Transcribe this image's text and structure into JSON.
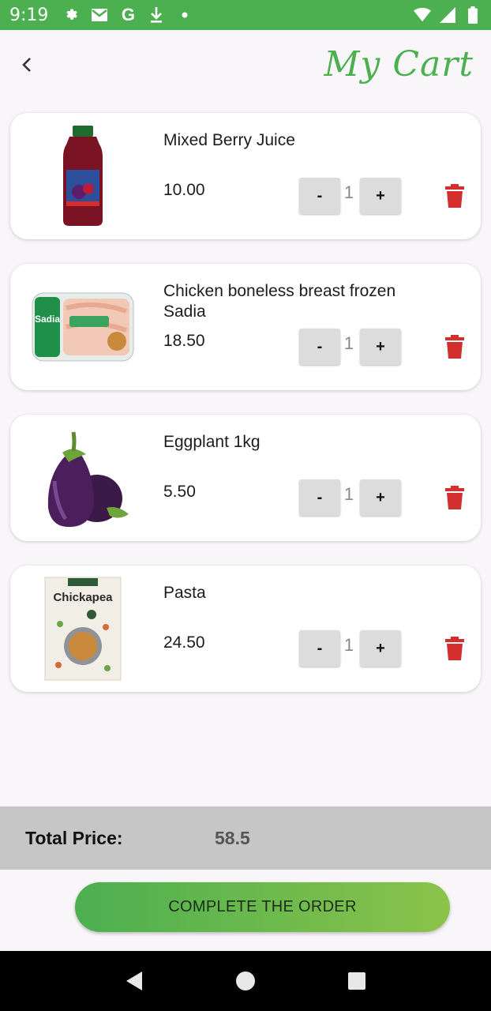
{
  "status_bar": {
    "time": "9:19",
    "icons_left": [
      "gear-icon",
      "mail-icon",
      "google-g-icon",
      "download-icon",
      "dot-icon"
    ],
    "icons_right": [
      "wifi-icon",
      "cell-signal-icon",
      "battery-icon"
    ],
    "google_letter": "G"
  },
  "header": {
    "title": "My Cart",
    "back_icon": "chevron-left-icon"
  },
  "cart": {
    "items": [
      {
        "name": "Mixed Berry Juice",
        "price": "10.00",
        "quantity": "1",
        "minus_label": "-",
        "plus_label": "+",
        "image": "juice-bottle-image"
      },
      {
        "name": "Chicken boneless breast frozen Sadia",
        "price": "18.50",
        "quantity": "1",
        "minus_label": "-",
        "plus_label": "+",
        "image": "chicken-pack-image",
        "brand_text": "Sadia"
      },
      {
        "name": "Eggplant 1kg",
        "price": "5.50",
        "quantity": "1",
        "minus_label": "-",
        "plus_label": "+",
        "image": "eggplant-image"
      },
      {
        "name": "Pasta",
        "price": "24.50",
        "quantity": "1",
        "minus_label": "-",
        "plus_label": "+",
        "image": "pasta-box-image",
        "brand_text": "Chickapea"
      }
    ]
  },
  "total": {
    "label": "Total Price:",
    "value": "58.5"
  },
  "actions": {
    "complete_label": "COMPLETE THE ORDER"
  },
  "nav_bar": {
    "icons": [
      "back-triangle-icon",
      "home-circle-icon",
      "recents-square-icon"
    ]
  },
  "colors": {
    "accent": "#4caf50",
    "accent_light": "#8bc34a",
    "delete": "#d32f2f",
    "total_bar": "#c6c6c6"
  }
}
